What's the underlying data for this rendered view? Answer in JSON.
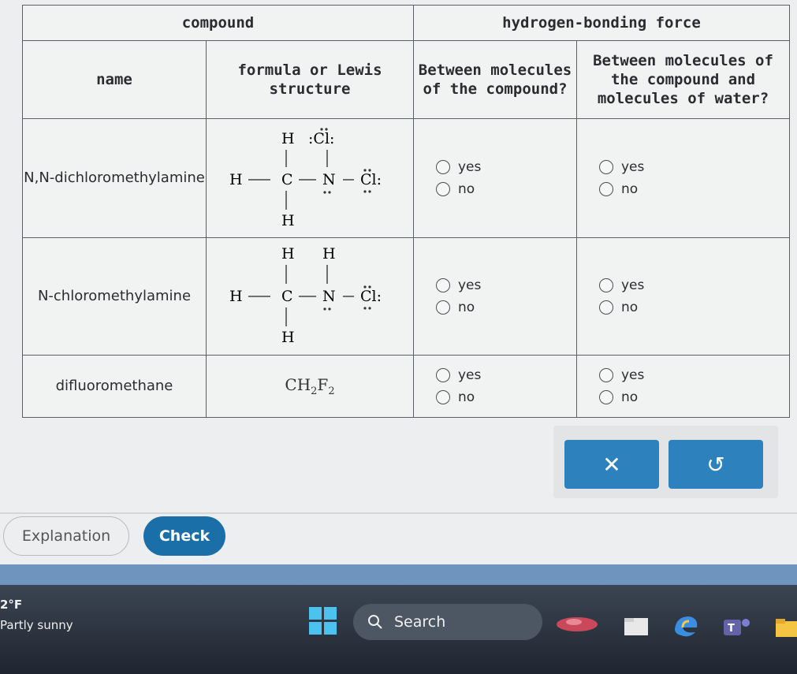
{
  "table": {
    "group_headers": {
      "compound": "compound",
      "hbond": "hydrogen-bonding force"
    },
    "col_headers": {
      "name": "name",
      "formula": "formula or Lewis structure",
      "between_compound": "Between molecules of the compound?",
      "between_water": "Between molecules of the compound and molecules of water?"
    },
    "rows": [
      {
        "name": "N,N-dichloromethylamine",
        "opt_yes": "yes",
        "opt_no": "no"
      },
      {
        "name": "N-chloromethylamine",
        "opt_yes": "yes",
        "opt_no": "no"
      },
      {
        "name": "difluoromethane",
        "opt_yes": "yes",
        "opt_no": "no"
      }
    ],
    "formula_row3": {
      "main": "CH",
      "sub1": "2",
      "f": "F",
      "sub2": "2"
    }
  },
  "lewis": {
    "H": "H",
    "C": "C",
    "N": "N",
    "Cl": "Cl"
  },
  "actions": {
    "clear_symbol": "✕",
    "undo_symbol": "↺"
  },
  "footer": {
    "explanation": "Explanation",
    "check": "Check"
  },
  "taskbar": {
    "temp": "2°F",
    "weather": "Partly sunny",
    "search": "Search"
  }
}
